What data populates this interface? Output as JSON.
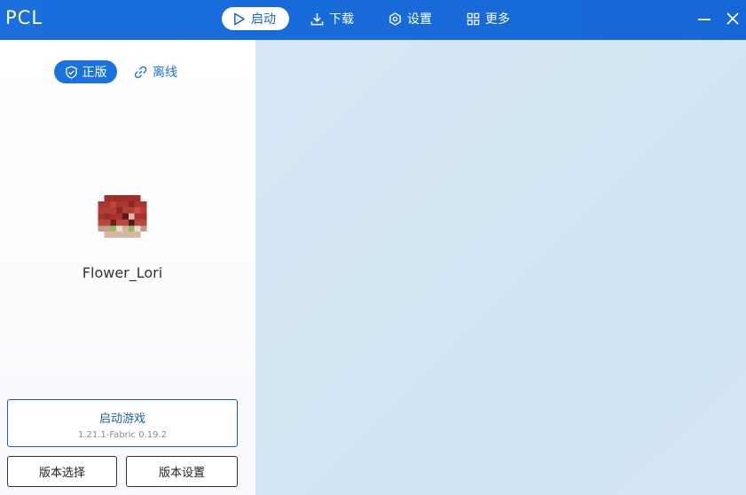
{
  "app": {
    "title": "PCL"
  },
  "nav": {
    "launch": "启动",
    "download": "下载",
    "settings": "设置",
    "more": "更多"
  },
  "sidebar": {
    "account_official": "正版",
    "account_offline": "离线",
    "username": "Flower_Lori",
    "launch_button": {
      "label": "启动游戏",
      "version": "1.21.1-Fabric 0.19.2"
    },
    "version_select": "版本选择",
    "version_settings": "版本设置"
  },
  "colors": {
    "accent": "#1a6fdc",
    "titlebar": "#1567d6",
    "main_bg": "#d3e6f4"
  },
  "icons": {
    "launch": "play-icon",
    "download": "download-icon",
    "settings": "gear-icon",
    "more": "grid-icon",
    "official": "shield-check-icon",
    "offline": "link-icon",
    "minimize": "minimize-icon",
    "close": "close-icon"
  }
}
